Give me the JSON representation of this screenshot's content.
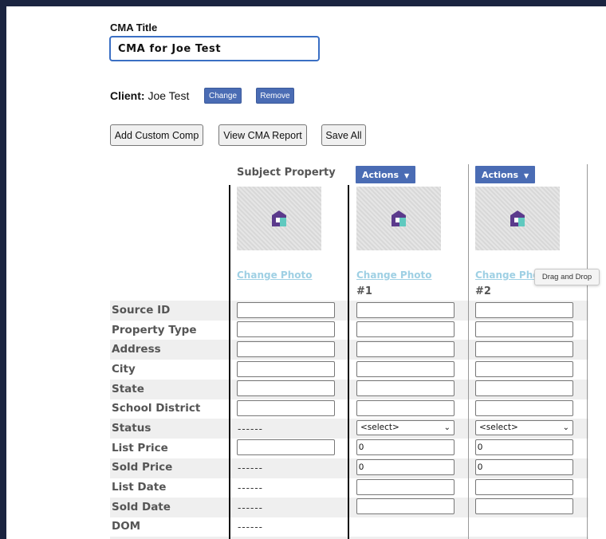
{
  "cma": {
    "title_label": "CMA Title",
    "title_value": "CMA for Joe Test"
  },
  "client": {
    "label": "Client:",
    "name": "Joe Test",
    "change_label": "Change",
    "remove_label": "Remove"
  },
  "toolbar": {
    "add_custom_comp": "Add Custom Comp",
    "view_report": "View CMA Report",
    "save_all": "Save All"
  },
  "grid": {
    "subject_title": "Subject Property",
    "actions_label": "Actions",
    "change_photo": "Change Photo",
    "change_photo_truncated": "Change Pho",
    "tooltip": "Drag and Drop",
    "comps": [
      "#1",
      "#2"
    ],
    "dashes": "------",
    "select_placeholder": "<select>",
    "rows": [
      "Source ID",
      "Property Type",
      "Address",
      "City",
      "State",
      "School District",
      "Status",
      "List Price",
      "Sold Price",
      "List Date",
      "Sold Date",
      "DOM"
    ],
    "comp_list_price": "0",
    "comp_sold_price": "0"
  },
  "colors": {
    "frame": "#1b2440",
    "button_blue": "#4a6cb4",
    "link": "#9fd0e4",
    "input_focus_border": "#3a6fc4"
  },
  "icons": {
    "house_logo": "house-logo-icon",
    "dropdown": "caret-down-icon"
  }
}
